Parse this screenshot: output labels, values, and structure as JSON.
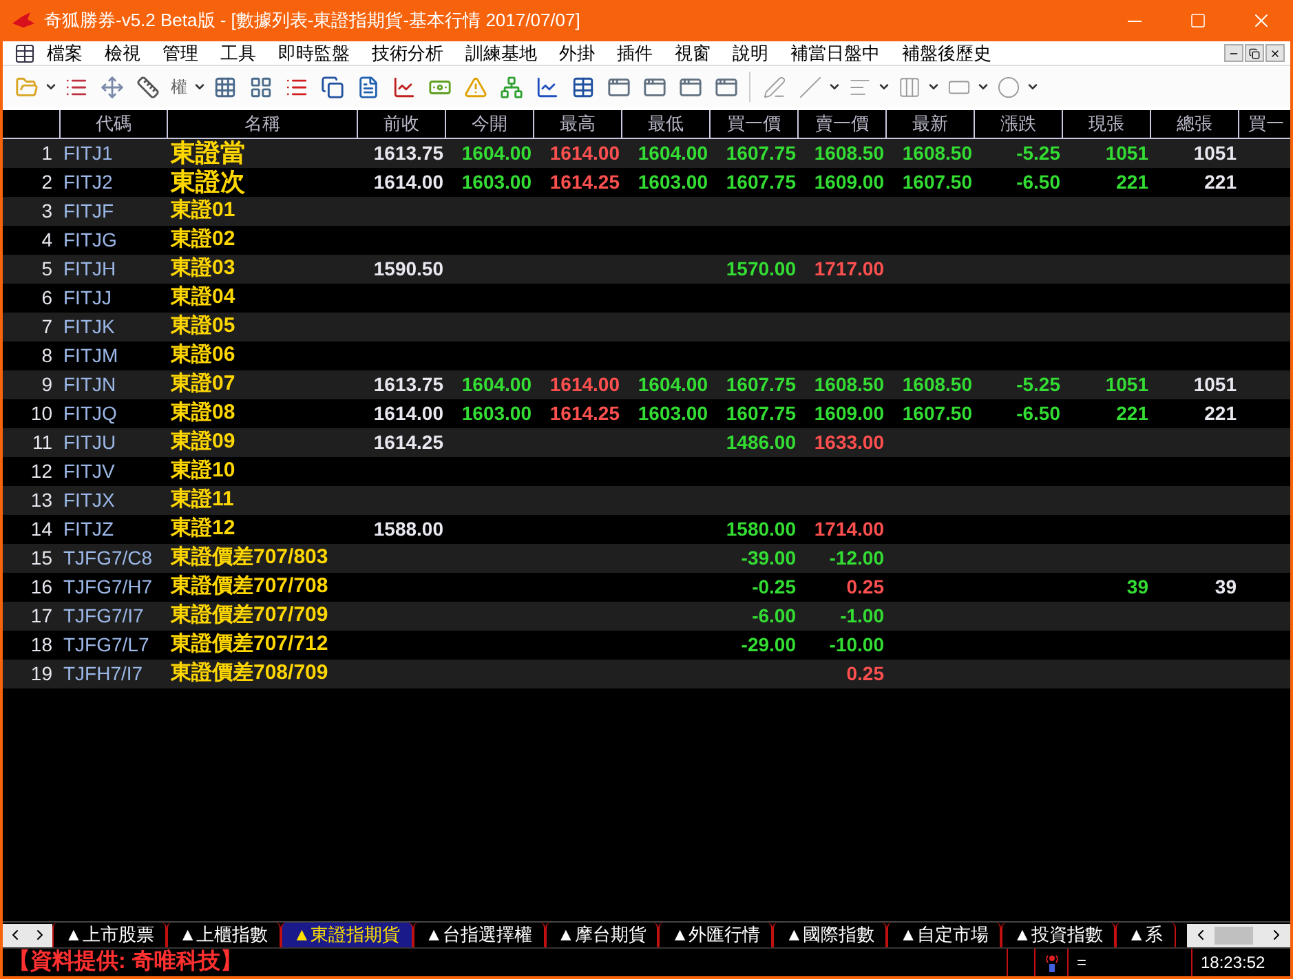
{
  "window": {
    "title": "奇狐勝券-v5.2 Beta版 - [數據列表-東證指期貨-基本行情 2017/07/07]"
  },
  "menu": [
    "檔案",
    "檢視",
    "管理",
    "工具",
    "即時監盤",
    "技術分析",
    "訓練基地",
    "外掛",
    "插件",
    "視窗",
    "說明",
    "補當日盤中",
    "補盤後歷史"
  ],
  "toolbar": {
    "rights_label": "權"
  },
  "table": {
    "columns": [
      "代碼",
      "名稱",
      "前收",
      "今開",
      "最高",
      "最低",
      "買一價",
      "賣一價",
      "最新",
      "漲跌",
      "現張",
      "總張",
      "買一"
    ],
    "rows": [
      {
        "no": "1",
        "code": "FITJ1",
        "name": "東證當",
        "large": true,
        "prev_close": {
          "text": "1613.75",
          "up": false,
          "down": false
        },
        "open": {
          "text": "1604.00",
          "up": false,
          "down": true
        },
        "high": {
          "text": "1614.00",
          "up": true,
          "down": false
        },
        "low": {
          "text": "1604.00",
          "up": false,
          "down": true
        },
        "bid": {
          "text": "1607.75",
          "up": false,
          "down": true
        },
        "ask": {
          "text": "1608.50",
          "up": false,
          "down": true
        },
        "last": {
          "text": "1608.50",
          "up": false,
          "down": true
        },
        "change": {
          "text": "-5.25",
          "up": false,
          "down": true
        },
        "volume": {
          "text": "1051",
          "up": false,
          "down": true
        },
        "total": {
          "text": "1051",
          "up": false,
          "down": false
        }
      },
      {
        "no": "2",
        "code": "FITJ2",
        "name": "東證次",
        "large": true,
        "prev_close": {
          "text": "1614.00",
          "up": false,
          "down": false
        },
        "open": {
          "text": "1603.00",
          "up": false,
          "down": true
        },
        "high": {
          "text": "1614.25",
          "up": true,
          "down": false
        },
        "low": {
          "text": "1603.00",
          "up": false,
          "down": true
        },
        "bid": {
          "text": "1607.75",
          "up": false,
          "down": true
        },
        "ask": {
          "text": "1609.00",
          "up": false,
          "down": true
        },
        "last": {
          "text": "1607.50",
          "up": false,
          "down": true
        },
        "change": {
          "text": "-6.50",
          "up": false,
          "down": true
        },
        "volume": {
          "text": "221",
          "up": false,
          "down": true
        },
        "total": {
          "text": "221",
          "up": false,
          "down": false
        }
      },
      {
        "no": "3",
        "code": "FITJF",
        "name": "東證01",
        "large": false
      },
      {
        "no": "4",
        "code": "FITJG",
        "name": "東證02",
        "large": false
      },
      {
        "no": "5",
        "code": "FITJH",
        "name": "東證03",
        "large": false,
        "prev_close": {
          "text": "1590.50",
          "up": false,
          "down": false
        },
        "bid": {
          "text": "1570.00",
          "up": false,
          "down": true
        },
        "ask": {
          "text": "1717.00",
          "up": true,
          "down": false
        }
      },
      {
        "no": "6",
        "code": "FITJJ",
        "name": "東證04",
        "large": false
      },
      {
        "no": "7",
        "code": "FITJK",
        "name": "東證05",
        "large": false
      },
      {
        "no": "8",
        "code": "FITJM",
        "name": "東證06",
        "large": false
      },
      {
        "no": "9",
        "code": "FITJN",
        "name": "東證07",
        "large": false,
        "prev_close": {
          "text": "1613.75",
          "up": false,
          "down": false
        },
        "open": {
          "text": "1604.00",
          "up": false,
          "down": true
        },
        "high": {
          "text": "1614.00",
          "up": true,
          "down": false
        },
        "low": {
          "text": "1604.00",
          "up": false,
          "down": true
        },
        "bid": {
          "text": "1607.75",
          "up": false,
          "down": true
        },
        "ask": {
          "text": "1608.50",
          "up": false,
          "down": true
        },
        "last": {
          "text": "1608.50",
          "up": false,
          "down": true
        },
        "change": {
          "text": "-5.25",
          "up": false,
          "down": true
        },
        "volume": {
          "text": "1051",
          "up": false,
          "down": true
        },
        "total": {
          "text": "1051",
          "up": false,
          "down": false
        }
      },
      {
        "no": "10",
        "code": "FITJQ",
        "name": "東證08",
        "large": false,
        "prev_close": {
          "text": "1614.00",
          "up": false,
          "down": false
        },
        "open": {
          "text": "1603.00",
          "up": false,
          "down": true
        },
        "high": {
          "text": "1614.25",
          "up": true,
          "down": false
        },
        "low": {
          "text": "1603.00",
          "up": false,
          "down": true
        },
        "bid": {
          "text": "1607.75",
          "up": false,
          "down": true
        },
        "ask": {
          "text": "1609.00",
          "up": false,
          "down": true
        },
        "last": {
          "text": "1607.50",
          "up": false,
          "down": true
        },
        "change": {
          "text": "-6.50",
          "up": false,
          "down": true
        },
        "volume": {
          "text": "221",
          "up": false,
          "down": true
        },
        "total": {
          "text": "221",
          "up": false,
          "down": false
        }
      },
      {
        "no": "11",
        "code": "FITJU",
        "name": "東證09",
        "large": false,
        "prev_close": {
          "text": "1614.25",
          "up": false,
          "down": false
        },
        "bid": {
          "text": "1486.00",
          "up": false,
          "down": true
        },
        "ask": {
          "text": "1633.00",
          "up": true,
          "down": false
        }
      },
      {
        "no": "12",
        "code": "FITJV",
        "name": "東證10",
        "large": false
      },
      {
        "no": "13",
        "code": "FITJX",
        "name": "東證11",
        "large": false
      },
      {
        "no": "14",
        "code": "FITJZ",
        "name": "東證12",
        "large": false,
        "prev_close": {
          "text": "1588.00",
          "up": false,
          "down": false
        },
        "bid": {
          "text": "1580.00",
          "up": false,
          "down": true
        },
        "ask": {
          "text": "1714.00",
          "up": true,
          "down": false
        }
      },
      {
        "no": "15",
        "code": "TJFG7/C8",
        "name": "東證價差707/803",
        "large": false,
        "bid": {
          "text": "-39.00",
          "up": false,
          "down": true
        },
        "ask": {
          "text": "-12.00",
          "up": false,
          "down": true
        }
      },
      {
        "no": "16",
        "code": "TJFG7/H7",
        "name": "東證價差707/708",
        "large": false,
        "bid": {
          "text": "-0.25",
          "up": false,
          "down": true
        },
        "ask": {
          "text": "0.25",
          "up": true,
          "down": false
        },
        "volume": {
          "text": "39",
          "up": false,
          "down": true
        },
        "total": {
          "text": "39",
          "up": false,
          "down": false
        }
      },
      {
        "no": "17",
        "code": "TJFG7/I7",
        "name": "東證價差707/709",
        "large": false,
        "bid": {
          "text": "-6.00",
          "up": false,
          "down": true
        },
        "ask": {
          "text": "-1.00",
          "up": false,
          "down": true
        }
      },
      {
        "no": "18",
        "code": "TJFG7/L7",
        "name": "東證價差707/712",
        "large": false,
        "bid": {
          "text": "-29.00",
          "up": false,
          "down": true
        },
        "ask": {
          "text": "-10.00",
          "up": false,
          "down": true
        }
      },
      {
        "no": "19",
        "code": "TJFH7/I7",
        "name": "東證價差708/709",
        "large": false,
        "ask": {
          "text": "0.25",
          "up": true,
          "down": false
        }
      }
    ]
  },
  "tabs": [
    {
      "label": "▲上市股票",
      "selected": false
    },
    {
      "label": "▲上櫃指數",
      "selected": false
    },
    {
      "label": "▲東證指期貨",
      "selected": true
    },
    {
      "label": "▲台指選擇權",
      "selected": false
    },
    {
      "label": "▲摩台期貨",
      "selected": false
    },
    {
      "label": "▲外匯行情",
      "selected": false
    },
    {
      "label": "▲國際指數",
      "selected": false
    },
    {
      "label": "▲自定市場",
      "selected": false
    },
    {
      "label": "▲投資指數",
      "selected": false
    },
    {
      "label": "▲系",
      "selected": false
    }
  ],
  "status_bar": {
    "source": "【資料提供: 奇唯科技】",
    "indicator": "=",
    "time": "18:23:52"
  }
}
